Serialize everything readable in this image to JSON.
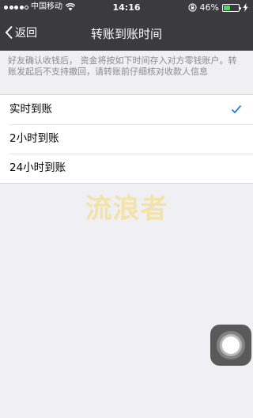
{
  "status_bar": {
    "carrier": "中国移动",
    "time": "14:16",
    "battery_percent": "46%",
    "battery_level": 0.46,
    "battery_color": "#4cd964",
    "signal_bars": 4,
    "icons": [
      "signal-icon",
      "wifi-icon",
      "orientation-lock-icon",
      "battery-icon",
      "charging-icon"
    ]
  },
  "nav": {
    "back_label": "返回",
    "title": "转账到账时间"
  },
  "notice": "好友确认收钱后， 资金将按如下时间存入对方零钱账户。转账发起后不支持撤回，请转账前仔细核对收款人信息",
  "options": [
    {
      "label": "实时到账",
      "selected": true
    },
    {
      "label": "2小时到账",
      "selected": false
    },
    {
      "label": "24小时到账",
      "selected": false
    }
  ],
  "accent_color": "#1aad19",
  "check_color": "#2d7be0",
  "watermark": "流浪者"
}
